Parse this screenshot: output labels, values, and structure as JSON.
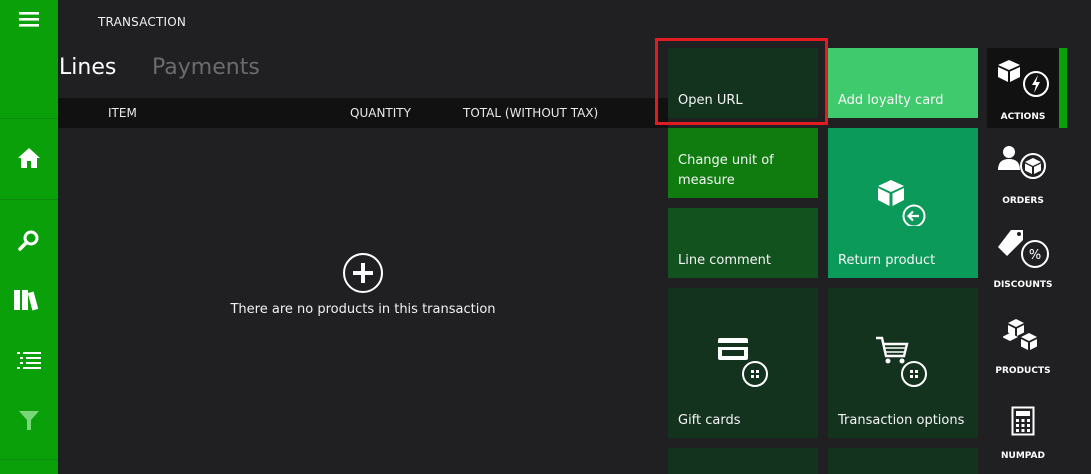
{
  "header": {
    "title": "TRANSACTION"
  },
  "tabs": {
    "lines": "Lines",
    "payments": "Payments"
  },
  "grid": {
    "col_item": "ITEM",
    "col_quantity": "QUANTITY",
    "col_total": "TOTAL (WITHOUT TAX)"
  },
  "empty": {
    "message": "There are no products in this transaction"
  },
  "tiles": {
    "open_url": "Open URL",
    "add_loyalty_card": "Add loyalty card",
    "change_unit_line1": "Change unit of",
    "change_unit_line2": "measure",
    "line_comment": "Line comment",
    "return_product": "Return product",
    "gift_cards": "Gift cards",
    "transaction_options": "Transaction options"
  },
  "rightpanel": {
    "actions": "ACTIONS",
    "orders": "ORDERS",
    "discounts": "DISCOUNTS",
    "products": "PRODUCTS",
    "numpad": "NUMPAD"
  },
  "colors": {
    "nav_green": "#0aa00a",
    "tile_dark": "#13331f",
    "tile_green": "#107c10",
    "tile_mid": "#12521f",
    "tile_light": "#3fca6e",
    "tile_teal": "#0c9a5a",
    "highlight": "#e21b23"
  }
}
